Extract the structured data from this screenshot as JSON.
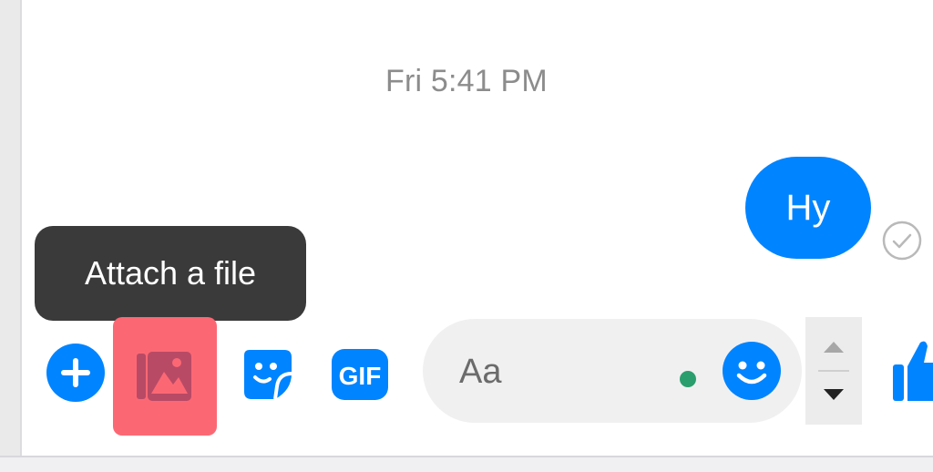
{
  "conversation": {
    "timestamp": "Fri 5:41 PM",
    "messages": [
      {
        "text": "Hy",
        "status_icon": "check-circle-icon"
      }
    ]
  },
  "tooltip": {
    "text": "Attach a file"
  },
  "toolbar": {
    "more_icon": "plus-circle-icon",
    "attach_icon": "photo-stack-icon",
    "sticker_icon": "sticker-icon",
    "gif_icon": "gif-icon",
    "gif_label": "GIF",
    "like_icon": "thumbs-up-icon"
  },
  "composer": {
    "placeholder": "Aa",
    "emoji_icon": "smiley-icon"
  },
  "scroll": {
    "up_icon": "triangle-up-icon",
    "down_icon": "triangle-down-icon"
  },
  "colors": {
    "accent": "#0084ff",
    "tooltip_bg": "#3a3a3a",
    "attach_highlight": "#fb6874",
    "attach_icon": "#b84a66",
    "composer_bg": "#f1f0f0",
    "online_dot": "#2b9e6e"
  }
}
